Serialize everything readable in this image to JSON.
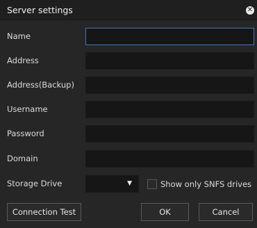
{
  "window": {
    "title": "Server settings",
    "close_glyph": "✕",
    "close_icon": "close-icon"
  },
  "fields": [
    {
      "key": "name",
      "label": "Name",
      "value": ""
    },
    {
      "key": "address",
      "label": "Address",
      "value": ""
    },
    {
      "key": "address_backup",
      "label": "Address(Backup)",
      "value": ""
    },
    {
      "key": "username",
      "label": "Username",
      "value": ""
    },
    {
      "key": "password",
      "label": "Password",
      "value": ""
    },
    {
      "key": "domain",
      "label": "Domain",
      "value": ""
    }
  ],
  "storage": {
    "label": "Storage Drive",
    "selected": "",
    "arrow_glyph": "▼",
    "arrow_icon": "chevron-down-icon"
  },
  "snfs_checkbox": {
    "label": "Show only SNFS drives",
    "checked": false
  },
  "buttons": {
    "connection_test": "Connection Test",
    "ok": "OK",
    "cancel": "Cancel"
  },
  "colors": {
    "titlebar": "#1f1f1f",
    "background": "#262626",
    "input": "#161616",
    "focus_border": "#3a78c4",
    "button_border": "#5b5b5b"
  }
}
